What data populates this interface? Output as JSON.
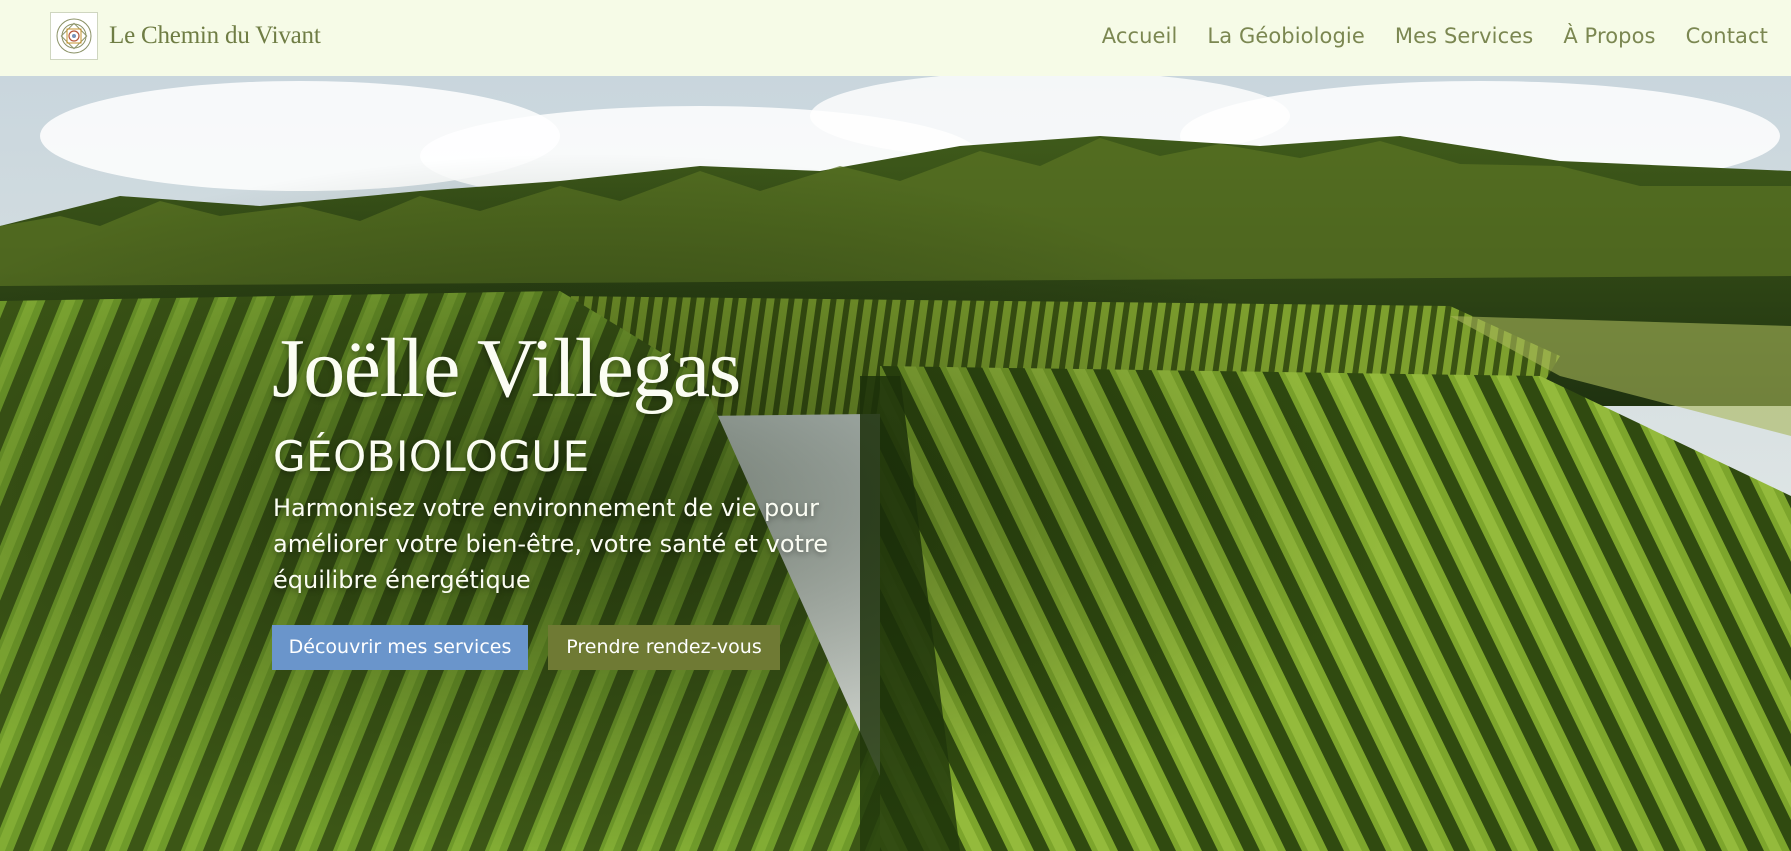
{
  "header": {
    "brand_name": "Le Chemin du Vivant",
    "logo_icon": "geometric-mandala-icon",
    "nav": [
      {
        "label": "Accueil"
      },
      {
        "label": "La Géobiologie"
      },
      {
        "label": "Mes Services"
      },
      {
        "label": "À Propos"
      },
      {
        "label": "Contact"
      }
    ]
  },
  "hero": {
    "name": "Joëlle Villegas",
    "role": "GÉOBIOLOGUE",
    "tagline": "Harmonisez votre environnement de vie pour améliorer votre bien-être, votre santé et votre équilibre énergétique",
    "primary_button": "Découvrir mes services",
    "secondary_button": "Prendre rendez-vous",
    "background_image": "vineyard-landscape-photo"
  },
  "colors": {
    "header_bg": "#f6fbe7",
    "brand_text": "#6f7d44",
    "nav_text": "#7b8751",
    "primary_button": "#6a95cb",
    "secondary_button": "#6f7a34",
    "hero_text": "#fbfdf3"
  }
}
